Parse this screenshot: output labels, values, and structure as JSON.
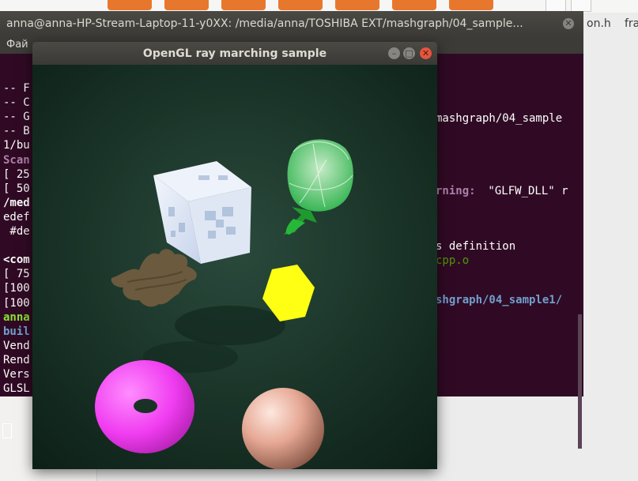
{
  "file_manager": {
    "file_label_1": "on.h",
    "file_label_2": "fra"
  },
  "terminal": {
    "title": "anna@anna-HP-Stream-Laptop-11-y0XX: /media/anna/TOSHIBA EXT/mashgraph/04_sample...",
    "close_glyph": "✕",
    "menu_file": "Фай",
    "lines_left": [
      {
        "text": "-- F",
        "style": ""
      },
      {
        "text": "-- C",
        "style": ""
      },
      {
        "text": "-- G",
        "style": ""
      },
      {
        "text": "-- B",
        "style": ""
      },
      {
        "text": "1/bu",
        "style": ""
      },
      {
        "text": "Scan",
        "style": "magenta"
      },
      {
        "text": "[ 25",
        "style": ""
      },
      {
        "text": "[ 50",
        "style": ""
      },
      {
        "text": "/med",
        "style": "bold"
      },
      {
        "text": "edef",
        "style": ""
      },
      {
        "text": " #de",
        "style": ""
      },
      {
        "text": "",
        "style": ""
      },
      {
        "text": "<com",
        "style": "bold"
      },
      {
        "text": "[ 75",
        "style": ""
      },
      {
        "text": "[100",
        "style": ""
      },
      {
        "text": "[100",
        "style": ""
      },
      {
        "text": "anna",
        "style": "green"
      },
      {
        "text": "buil",
        "style": "blue"
      },
      {
        "text": "Vend",
        "style": ""
      },
      {
        "text": "Rend",
        "style": ""
      },
      {
        "text": "Vers",
        "style": ""
      },
      {
        "text": "GLSL",
        "style": ""
      }
    ],
    "right_mashgraph": "mashgraph/04_sample",
    "right_warning_label": "rning:",
    "right_warning_text": " \"GLFW_DLL\" r",
    "right_definition": "s definition",
    "right_cpp": "cpp.o",
    "right_path": "shgraph/04_sample1/"
  },
  "gl_window": {
    "title": "OpenGL ray marching sample",
    "minimize_glyph": "–",
    "maximize_glyph": "□",
    "close_glyph": "✕"
  },
  "colors": {
    "terminal_bg": "#300a24",
    "scene_bg": "#1e3a2e",
    "torus": "#f03cf0",
    "hexagon": "#ffff14",
    "sphere": "#e6a894",
    "menger_cube": "#dfe8f8",
    "tree": "#8ae8a0",
    "fractal": "#5a4a30"
  }
}
